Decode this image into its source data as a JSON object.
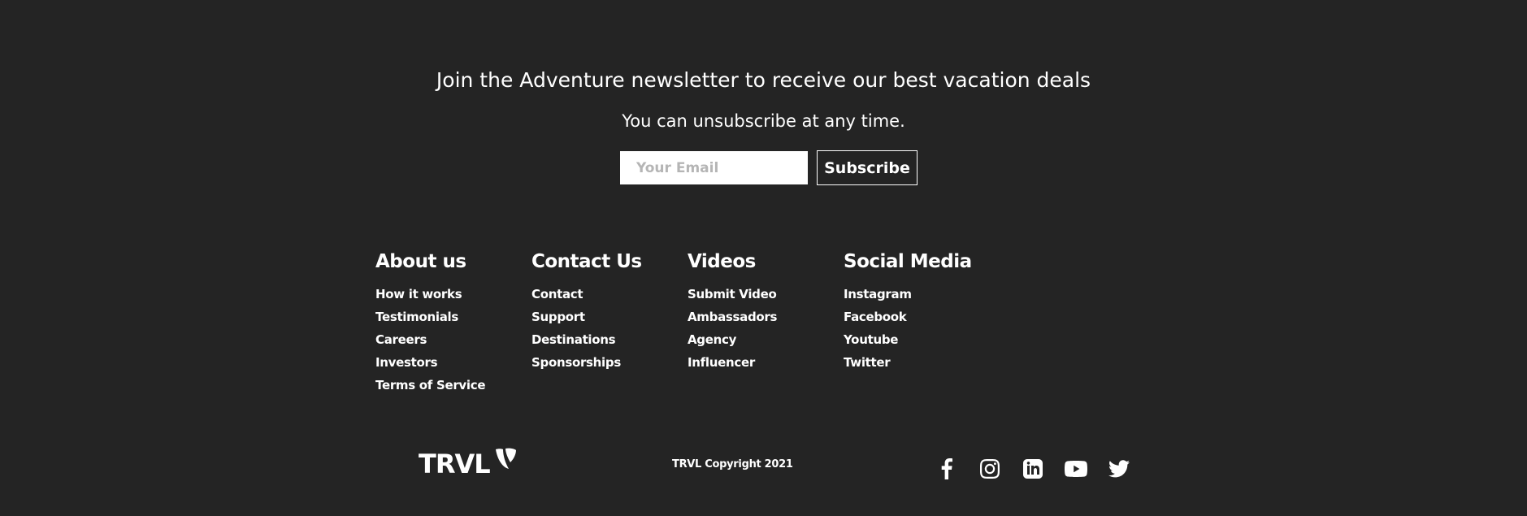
{
  "newsletter": {
    "heading": "Join the Adventure newsletter to receive our best vacation deals",
    "subheading": "You can unsubscribe at any time.",
    "email_placeholder": "Your Email",
    "subscribe_label": "Subscribe"
  },
  "columns": [
    {
      "title": "About us",
      "links": [
        "How it works",
        "Testimonials",
        "Careers",
        "Investors",
        "Terms of Service"
      ]
    },
    {
      "title": "Contact Us",
      "links": [
        "Contact",
        "Support",
        "Destinations",
        "Sponsorships"
      ]
    },
    {
      "title": "Videos",
      "links": [
        "Submit Video",
        "Ambassadors",
        "Agency",
        "Influencer"
      ]
    },
    {
      "title": "Social Media",
      "links": [
        "Instagram",
        "Facebook",
        "Youtube",
        "Twitter"
      ]
    }
  ],
  "footer": {
    "logo_text": "TRVL",
    "copyright": "TRVL Copyright 2021",
    "social_icons": [
      "facebook-icon",
      "instagram-icon",
      "linkedin-icon",
      "youtube-icon",
      "twitter-icon"
    ]
  },
  "colors": {
    "background": "#242424",
    "text": "#ffffff",
    "input_bg": "#ffffff",
    "placeholder": "#b5b5b5"
  }
}
